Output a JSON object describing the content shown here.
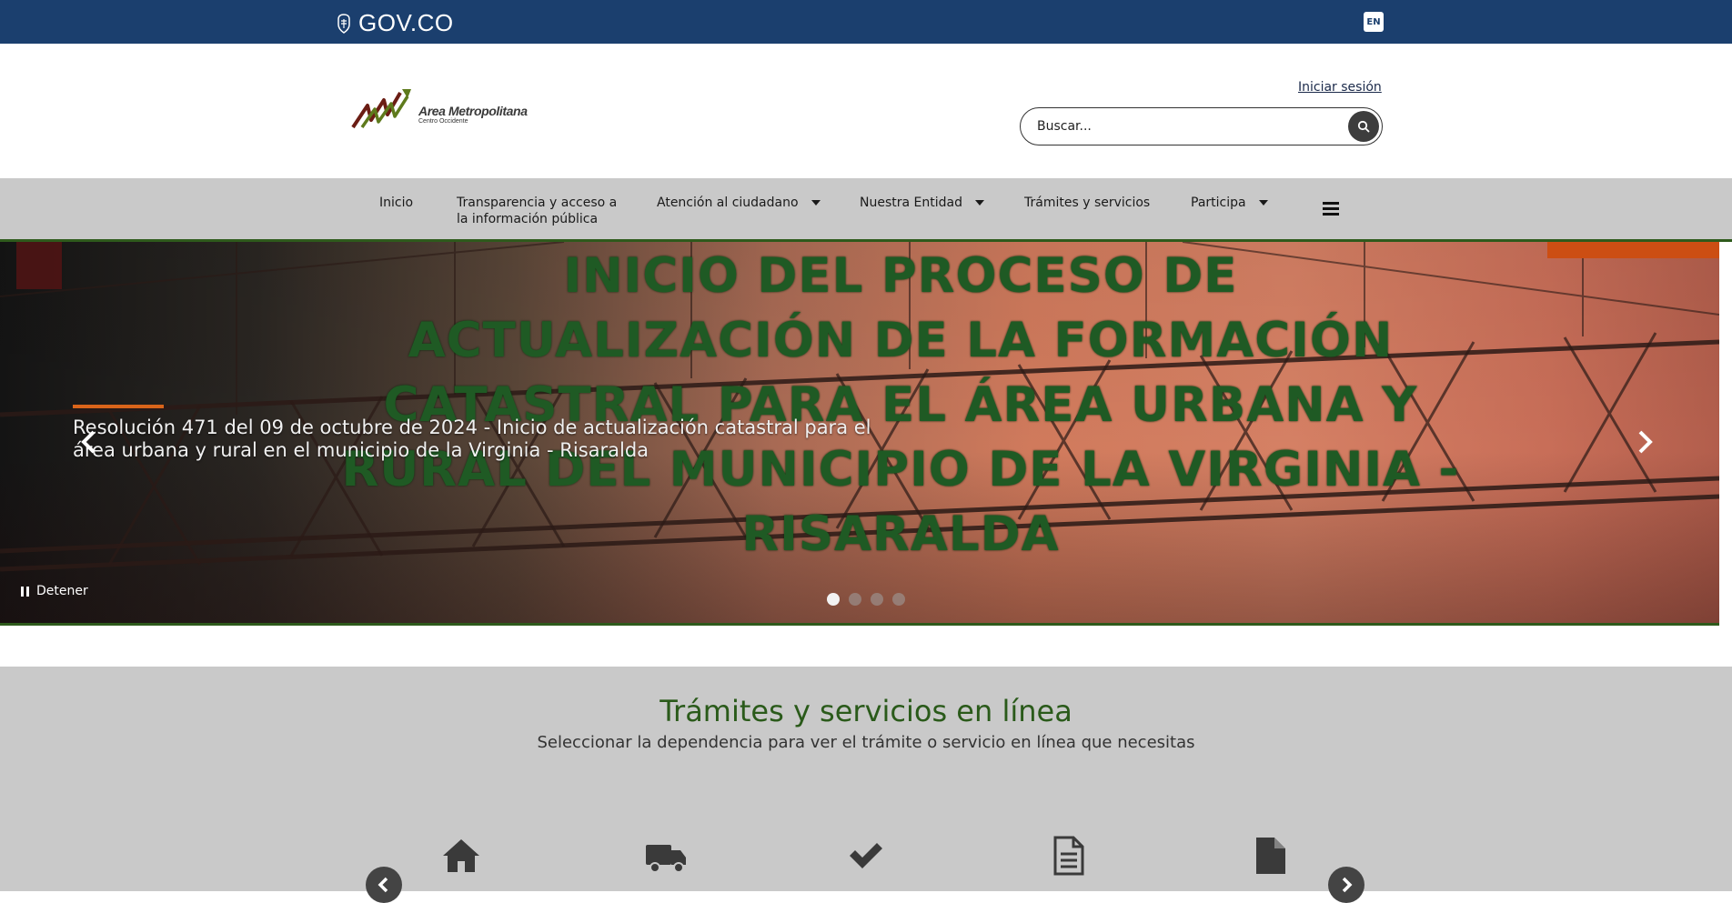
{
  "govbar": {
    "logo_text": "GOV.CO",
    "language_button": "EN"
  },
  "header": {
    "brand_name": "Area Metropolitana",
    "brand_subtitle": "Centro Occidente",
    "login_link": "Iniciar sesión",
    "search_placeholder": "Buscar..."
  },
  "nav": {
    "items": [
      {
        "label": "Inicio",
        "has_dropdown": false
      },
      {
        "label": "Transparencia y acceso a la información pública",
        "has_dropdown": false
      },
      {
        "label": "Atención al ciudadano",
        "has_dropdown": true
      },
      {
        "label": "Nuestra Entidad",
        "has_dropdown": true
      },
      {
        "label": "Trámites y servicios",
        "has_dropdown": false
      },
      {
        "label": "Participa",
        "has_dropdown": true
      }
    ],
    "menu_icon": "hamburger-icon"
  },
  "hero": {
    "headline": "INICIO DEL PROCESO DE ACTUALIZACIÓN DE LA FORMACIÓN CATASTRAL PARA EL ÁREA URBANA Y RURAL DEL MUNICIPIO DE LA VIRGINIA - RISARALDA",
    "caption": "Resolución 471 del 09 de octubre de 2024 - Inicio de actualización catastral para el área urbana y rural en el municipio de la Virginia - Risaralda",
    "stop_label": "Detener",
    "slide_count": 4,
    "active_slide": 1
  },
  "services": {
    "title": "Trámites y servicios en línea",
    "subtitle": "Seleccionar la dependencia para ver el trámite o servicio en línea que necesitas",
    "icons": [
      "home-icon",
      "truck-icon",
      "check-icon",
      "document-lines-icon",
      "file-icon"
    ]
  },
  "colors": {
    "govbar": "#1b3f6e",
    "nav_bg": "#c9c9c9",
    "headline_green": "#1f5a24",
    "accent_orange": "#cc4e13",
    "section_title_green": "#2a5a1a"
  }
}
